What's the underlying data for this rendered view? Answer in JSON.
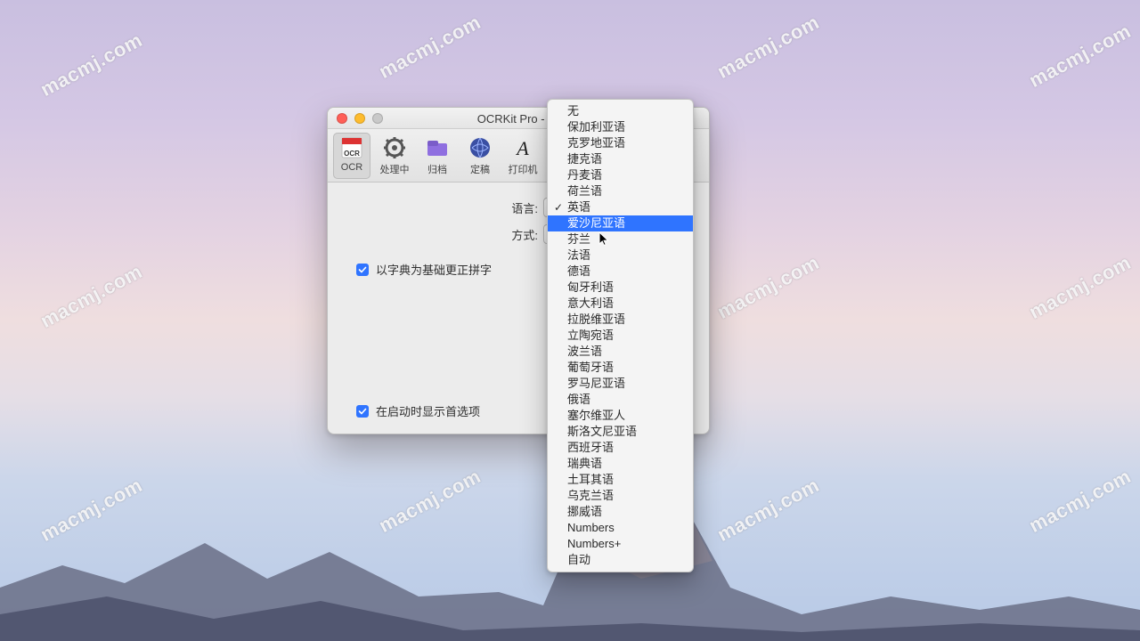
{
  "watermark_text": "macmj.com",
  "window": {
    "title": "OCRKit Pro - 偏",
    "toolbar": [
      {
        "id": "ocr",
        "label": "OCR",
        "active": true
      },
      {
        "id": "process",
        "label": "处理中",
        "active": false
      },
      {
        "id": "archive",
        "label": "归档",
        "active": false
      },
      {
        "id": "final",
        "label": "定稿",
        "active": false
      },
      {
        "id": "printer",
        "label": "打印机",
        "active": false
      }
    ],
    "form": {
      "language_label": "语言:",
      "method_label": "方式:"
    },
    "checkboxes": {
      "dict_correct": "以字典为基础更正拼字",
      "show_prefs": "在启动时显示首选项"
    }
  },
  "dropdown": {
    "checked": "英语",
    "highlighted": "爱沙尼亚语",
    "items": [
      "无",
      "保加利亚语",
      "克罗地亚语",
      "捷克语",
      "丹麦语",
      "荷兰语",
      "英语",
      "爱沙尼亚语",
      "芬兰",
      "法语",
      "德语",
      "匈牙利语",
      "意大利语",
      "拉脱维亚语",
      "立陶宛语",
      "波兰语",
      "葡萄牙语",
      "罗马尼亚语",
      "俄语",
      "塞尔维亚人",
      "斯洛文尼亚语",
      "西班牙语",
      "瑞典语",
      "土耳其语",
      "乌克兰语",
      "挪威语",
      "Numbers",
      "Numbers+",
      "自动"
    ]
  }
}
